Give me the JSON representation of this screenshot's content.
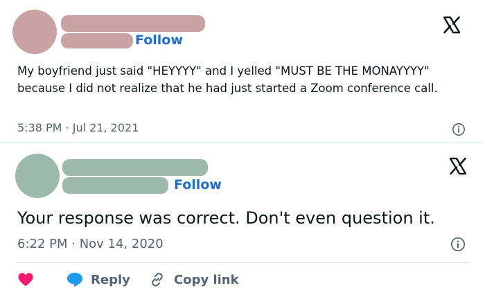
{
  "tweets": [
    {
      "follow_label": "Follow",
      "text": "My boyfriend just said \"HEYYYY\" and I yelled \"MUST BE THE MONAYYYY\" because I did not realize that he had just started a Zoom conference call.",
      "timestamp": "5:38 PM · Jul 21, 2021",
      "avatar_color": "#c9a3a3",
      "name_bar_color": "#c9a3a3"
    },
    {
      "follow_label": "Follow",
      "text": "Your response was correct. Don't even question it.",
      "timestamp": "6:22 PM · Nov 14, 2020",
      "avatar_color": "#9bb9ad",
      "name_bar_color": "#9bb9ad"
    }
  ],
  "actions": {
    "reply_label": "Reply",
    "copy_link_label": "Copy link"
  },
  "colors": {
    "follow": "#1d6fcf",
    "heart": "#f4196e",
    "reply_bubble": "#1d9bf0",
    "muted": "#536471"
  },
  "icons": [
    "x-logo-icon",
    "info-icon",
    "heart-icon",
    "reply-icon",
    "link-icon"
  ]
}
